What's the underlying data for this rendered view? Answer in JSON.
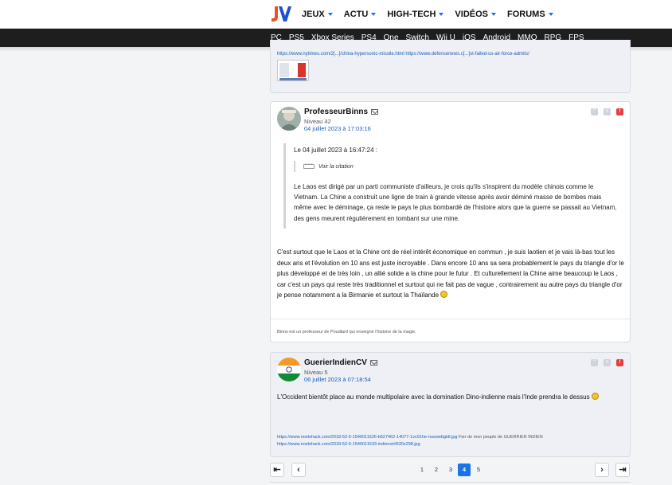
{
  "nav": {
    "main": [
      {
        "label": "JEUX"
      },
      {
        "label": "ACTU"
      },
      {
        "label": "HIGH-TECH"
      },
      {
        "label": "VIDÉOS"
      },
      {
        "label": "FORUMS"
      }
    ],
    "platforms": [
      "PC",
      "PS5",
      "Xbox Series",
      "PS4",
      "One",
      "Switch",
      "Wii U",
      "iOS",
      "Android",
      "MMO",
      "RPG",
      "FPS"
    ]
  },
  "prev_post": {
    "links": "https://www.nytimes.com/2[...]/china-hypersonic-missile.html https://www.defensenews.c[...]st-failed-us-air-force-admits/"
  },
  "post1": {
    "author": "ProfesseurBinns",
    "level": "Niveau 42",
    "date": "04 juillet 2023 à 17:03:16",
    "quote_head": "Le 04 juillet 2023 à 16:47:24 :",
    "quote_nested": "Voir la citation",
    "quote_body": "Le Laos est dirigé par un parti communiste d'ailleurs, je crois qu'ils s'inspirent du modèle chinois comme le Vietnam. La Chine a construit une ligne de train à grande vitesse après avoir déminé masse de bombes mais même avec le déminage, ça reste le pays le plus bombardé de l'histoire alors que la guerre se passait au Vietnam, des gens meurent régulièrement en tombant sur une mine.",
    "body": "C'est surtout que le Laos et la Chine ont de réel intérêt économique en commun , je suis laotien et je vais là-bas tout les deux ans et l'évolution en 10 ans est juste incroyable . Dans encore 10 ans sa sera probablement le pays du triangle d'or le plus développé et de très loin , un allié solide a la chine pour le futur . Et culturellement la Chine aime beaucoup le Laos , car c'est un pays qui reste très traditionnel et surtout qui ne fait pas de vague , contrairement au autre pays du triangle d'or je pense notamment a la Birmanie et surtout la Thaïlande",
    "signature": "Binns est un professeur de Poudlard qui enseigne l'histoire de la magie."
  },
  "post2": {
    "author": "GuerierIndienCV",
    "level": "Niveau 5",
    "date": "06 juillet 2023 à 07:18:54",
    "body": "L'Occident bientôt place au monde multipolaire avec la domination Dino-indienne mais l'Inde prendra le dessus",
    "sig_link1": "https://www.noelshack.com/2018-52-5-1546011526-b627462-14077-1vc91he-nuowebgldl.jpg",
    "sig_text1": " Fier de mon peuple de GUERRIER INDIEN",
    "sig_link2": "https://www.noelshack.com/2018-52-5-1546011533-indienviril530x298.jpg"
  },
  "pagination": {
    "pages": [
      "1",
      "2",
      "3",
      "4",
      "5"
    ],
    "current": "4"
  },
  "colors": {
    "accent": "#1a73e8",
    "alert": "#e34040",
    "platbar": "#1e1e1e"
  }
}
